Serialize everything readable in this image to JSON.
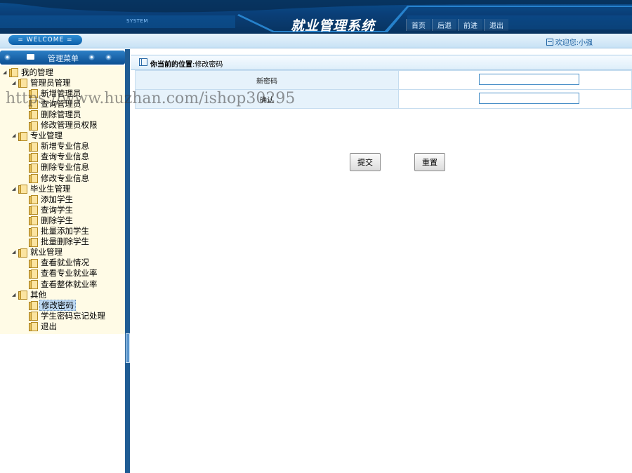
{
  "header": {
    "system_tag": "SYSTEM",
    "title": "就业管理系统",
    "nav": [
      "首页",
      "后退",
      "前进",
      "退出"
    ]
  },
  "welcome": {
    "badge": "= WELCOME =",
    "greeting": "欢迎您:小强"
  },
  "sidebar": {
    "menu_title": "管理菜单",
    "tree": [
      {
        "label": "我的管理",
        "level": 0,
        "expanded": true
      },
      {
        "label": "管理员管理",
        "level": 1,
        "expanded": true
      },
      {
        "label": "新增管理员",
        "level": 2
      },
      {
        "label": "查询管理员",
        "level": 2
      },
      {
        "label": "删除管理员",
        "level": 2
      },
      {
        "label": "修改管理员权限",
        "level": 2
      },
      {
        "label": "专业管理",
        "level": 1,
        "expanded": true
      },
      {
        "label": "新增专业信息",
        "level": 2
      },
      {
        "label": "查询专业信息",
        "level": 2
      },
      {
        "label": "删除专业信息",
        "level": 2
      },
      {
        "label": "修改专业信息",
        "level": 2
      },
      {
        "label": "毕业生管理",
        "level": 1,
        "expanded": true
      },
      {
        "label": "添加学生",
        "level": 2
      },
      {
        "label": "查询学生",
        "level": 2
      },
      {
        "label": "删除学生",
        "level": 2
      },
      {
        "label": "批量添加学生",
        "level": 2
      },
      {
        "label": "批量删除学生",
        "level": 2
      },
      {
        "label": "就业管理",
        "level": 1,
        "expanded": true
      },
      {
        "label": "查看就业情况",
        "level": 2
      },
      {
        "label": "查看专业就业率",
        "level": 2
      },
      {
        "label": "查看整体就业率",
        "level": 2
      },
      {
        "label": "其他",
        "level": 1,
        "expanded": true
      },
      {
        "label": "修改密码",
        "level": 2,
        "selected": true
      },
      {
        "label": "学生密码忘记处理",
        "level": 2
      },
      {
        "label": "退出",
        "level": 2
      }
    ]
  },
  "content": {
    "location_prefix": "你当前的位置",
    "location_page": ":修改密码",
    "fields": [
      {
        "label": "新密码",
        "value": ""
      },
      {
        "label": "确认",
        "value": ""
      }
    ],
    "submit_label": "提交",
    "reset_label": "重置"
  },
  "watermark": "https://www.huzhan.com/ishop30295",
  "colors": {
    "header": "#0a3f78",
    "sidebar_bg": "#fffbe6",
    "splitter": "#1f5c94",
    "label_cell": "#e6f2fb"
  }
}
